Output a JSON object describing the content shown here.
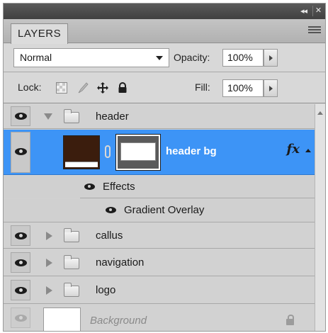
{
  "panel": {
    "tab_label": "LAYERS",
    "collapse_glyph": "◂◂",
    "close_glyph": "✕"
  },
  "options": {
    "blend_mode": "Normal",
    "opacity_label": "Opacity:",
    "opacity_value": "100%",
    "lock_label": "Lock:",
    "fill_label": "Fill:",
    "fill_value": "100%"
  },
  "icons": {
    "lock_transparent": "checker-icon",
    "lock_image": "brush-icon",
    "lock_position": "move-icon",
    "lock_all": "lock-icon",
    "fx": "fx"
  },
  "layers": [
    {
      "name": "header",
      "type": "group",
      "expanded": true,
      "visible": true
    },
    {
      "name": "header bg",
      "type": "layer",
      "selected": true,
      "visible": true,
      "has_effects": true
    },
    {
      "name": "Effects",
      "type": "effects-header"
    },
    {
      "name": "Gradient Overlay",
      "type": "effect"
    },
    {
      "name": "callus",
      "type": "group",
      "expanded": false,
      "visible": true
    },
    {
      "name": "navigation",
      "type": "group",
      "expanded": false,
      "visible": true
    },
    {
      "name": "logo",
      "type": "group",
      "expanded": false,
      "visible": true
    },
    {
      "name": "Background",
      "type": "background",
      "locked": true,
      "visible": true
    }
  ],
  "colors": {
    "selection": "#3d94f6",
    "panel_bg": "#d6d6d6",
    "header_bg_swatch": "#3b1d0d"
  }
}
